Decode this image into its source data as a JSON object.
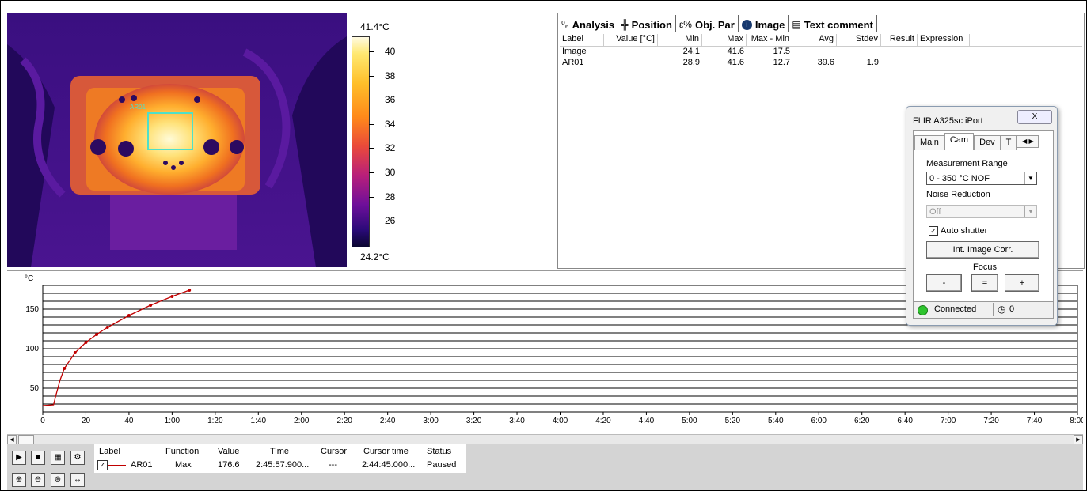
{
  "thermal": {
    "scale_max": "41.4°C",
    "scale_min": "24.2°C",
    "ticks": [
      "40",
      "38",
      "36",
      "34",
      "32",
      "30",
      "28",
      "26"
    ],
    "roi_label": "AR01"
  },
  "analysis": {
    "tabs": [
      {
        "icon": "analysis-icon",
        "label": "Analysis"
      },
      {
        "icon": "position-icon",
        "label": "Position"
      },
      {
        "icon": "obj-par-icon",
        "label": "Obj. Par"
      },
      {
        "icon": "info-icon",
        "label": "Image"
      },
      {
        "icon": "text-comment-icon",
        "label": "Text comment"
      }
    ],
    "columns": [
      "Label",
      "Value [°C]",
      "Min",
      "Max",
      "Max - Min",
      "Avg",
      "Stdev",
      "Result",
      "Expression"
    ],
    "rows": [
      {
        "label": "Image",
        "value": "",
        "min": "24.1",
        "max": "41.6",
        "maxmin": "17.5",
        "avg": "",
        "stdev": "",
        "result": "",
        "expression": ""
      },
      {
        "label": "AR01",
        "value": "",
        "min": "28.9",
        "max": "41.6",
        "maxmin": "12.7",
        "avg": "39.6",
        "stdev": "1.9",
        "result": "",
        "expression": ""
      }
    ]
  },
  "dialog": {
    "title": "FLIR A325sc iPort",
    "close": "X",
    "tabs": [
      "Main",
      "Cam",
      "Dev",
      "T"
    ],
    "measurement_range_label": "Measurement Range",
    "measurement_range_value": "0 - 350 °C NOF",
    "noise_reduction_label": "Noise Reduction",
    "noise_reduction_value": "Off",
    "auto_shutter_label": "Auto shutter",
    "int_image_corr": "Int. Image Corr.",
    "focus_label": "Focus",
    "focus_minus": "-",
    "focus_eq": "=",
    "focus_plus": "+",
    "status": "Connected",
    "counter": "0"
  },
  "chart_data": {
    "type": "line",
    "ylabel": "°C",
    "y_ticks": [
      "150",
      "100",
      "50"
    ],
    "x_ticks": [
      "0",
      "20",
      "40",
      "1:00",
      "1:20",
      "1:40",
      "2:00",
      "2:20",
      "2:40",
      "3:00",
      "3:20",
      "3:40",
      "4:00",
      "4:20",
      "4:40",
      "5:00",
      "5:20",
      "5:40",
      "6:00",
      "6:20",
      "6:40",
      "7:00",
      "7:20",
      "7:40",
      "8:00"
    ],
    "ylim": [
      20,
      180
    ],
    "xlim": [
      0,
      480
    ],
    "grid": true,
    "series": [
      {
        "name": "AR01",
        "color": "#c00000",
        "x": [
          0,
          5,
          6,
          8,
          10,
          15,
          20,
          25,
          30,
          40,
          50,
          60,
          68
        ],
        "y": [
          28,
          29,
          40,
          60,
          75,
          95,
          108,
          118,
          127,
          142,
          155,
          166,
          174
        ]
      }
    ]
  },
  "bottom": {
    "columns": [
      "Label",
      "Function",
      "Value",
      "Time",
      "Cursor",
      "Cursor time",
      "Status"
    ],
    "row": {
      "label": "AR01",
      "function": "Max",
      "value": "176.6",
      "time": "2:45:57.900...",
      "cursor": "---",
      "cursor_time": "2:44:45.000...",
      "status": "Paused"
    }
  }
}
